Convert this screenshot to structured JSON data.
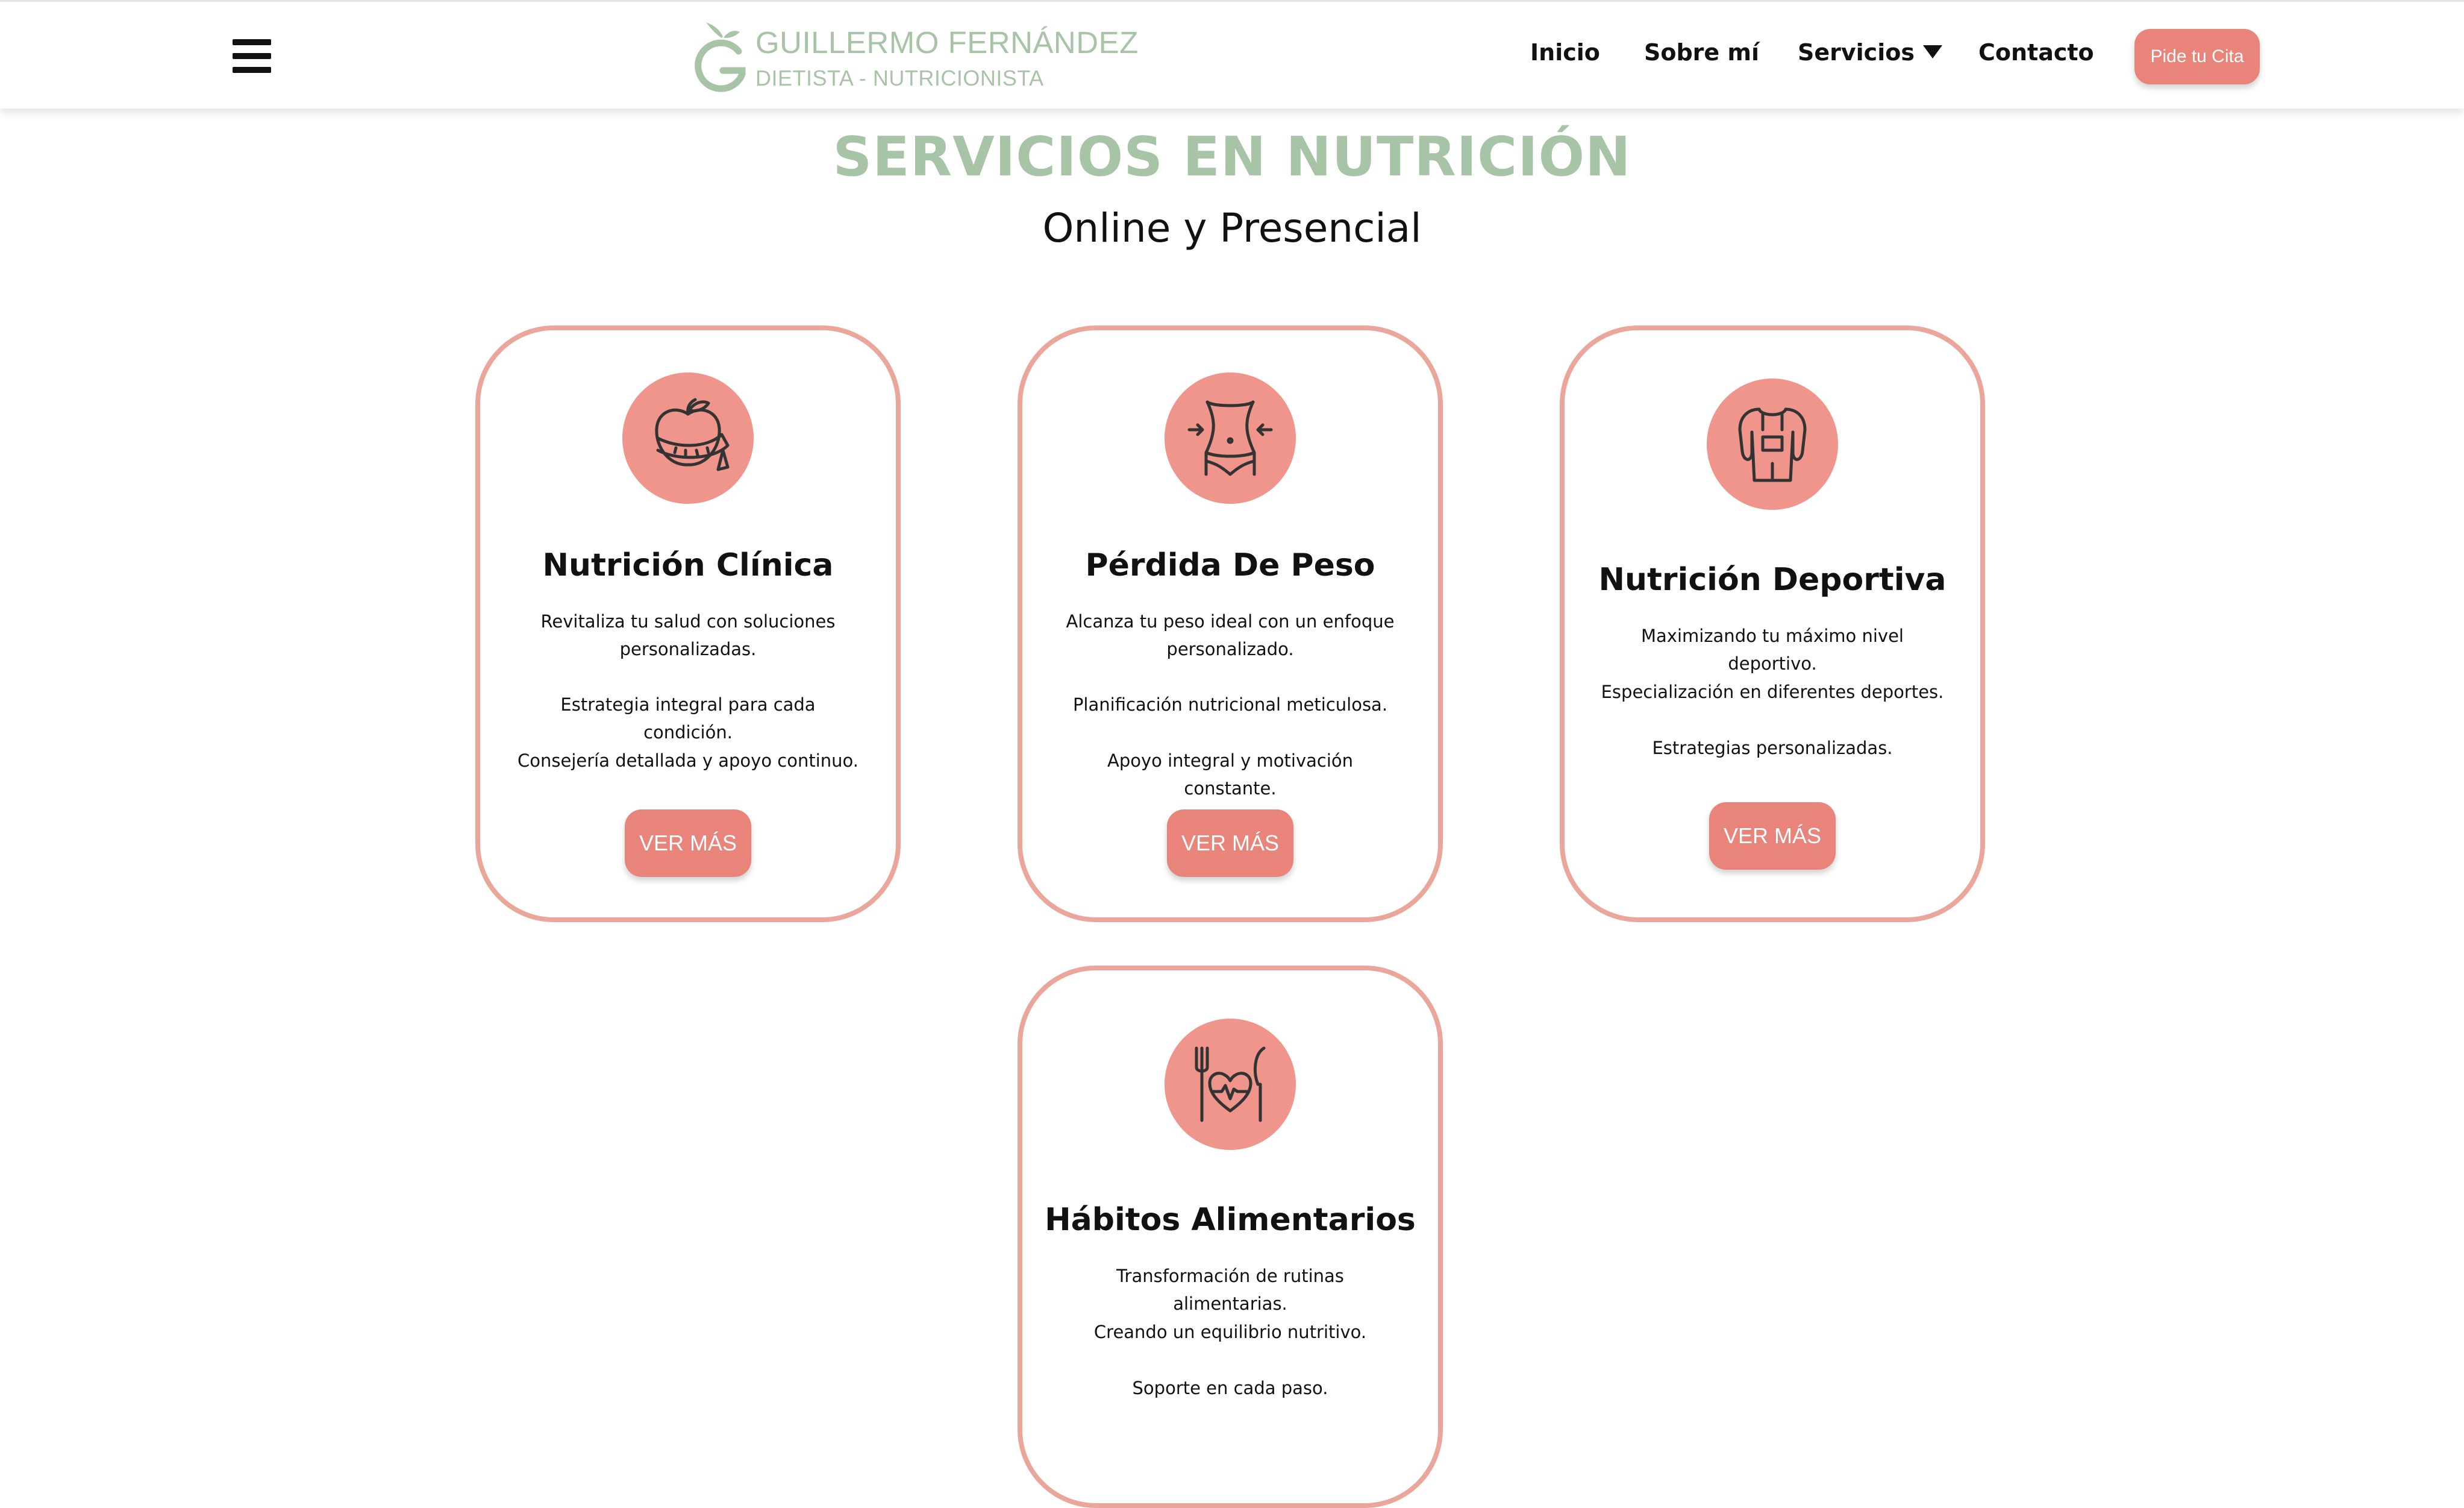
{
  "header": {
    "logo": {
      "name": "GUILLERMO FERNÁNDEZ",
      "subtitle": "DIETISTA - NUTRICIONISTA",
      "icon": "g-apple-logo-icon"
    },
    "nav": [
      {
        "label": "Inicio"
      },
      {
        "label": "Sobre mí"
      },
      {
        "label": "Servicios",
        "dropdown": true
      },
      {
        "label": "Contacto"
      }
    ],
    "cta_label": "Pide tu Cita",
    "menu_icon": "hamburger-menu-icon"
  },
  "main": {
    "title": "SERVICIOS EN NUTRICIÓN",
    "subtitle": "Online y Presencial",
    "cards": [
      {
        "title": "Nutrición Clínica",
        "icon": "apple-measuring-tape-icon",
        "lines": [
          "Revitaliza tu salud con soluciones personalizadas.",
          "Estrategia integral para cada condición.",
          "Consejería detallada y apoyo continuo."
        ],
        "button": "VER MÁS"
      },
      {
        "title": "Pérdida De Peso",
        "icon": "waist-slimming-icon",
        "lines": [
          "Alcanza tu peso ideal con un enfoque personalizado.",
          "Planificación nutricional meticulosa.",
          "Apoyo integral y motivación constante."
        ],
        "button": "VER MÁS"
      },
      {
        "title": "Nutrición Deportiva",
        "icon": "athlete-torso-icon",
        "lines": [
          "Maximizando tu máximo nivel deportivo.",
          "Especialización en diferentes deportes.",
          "Estrategias personalizadas."
        ],
        "button": "VER MÁS"
      },
      {
        "title": "Hábitos Alimentarios",
        "icon": "fork-knife-heart-icon",
        "lines": [
          "Transformación de rutinas alimentarias.",
          "Creando un equilibrio nutritivo.",
          "Soporte en cada paso."
        ]
      }
    ]
  },
  "colors": {
    "accent_green": "#a8c4a6",
    "accent_salmon": "#e9847a",
    "card_border": "#eba69b"
  }
}
